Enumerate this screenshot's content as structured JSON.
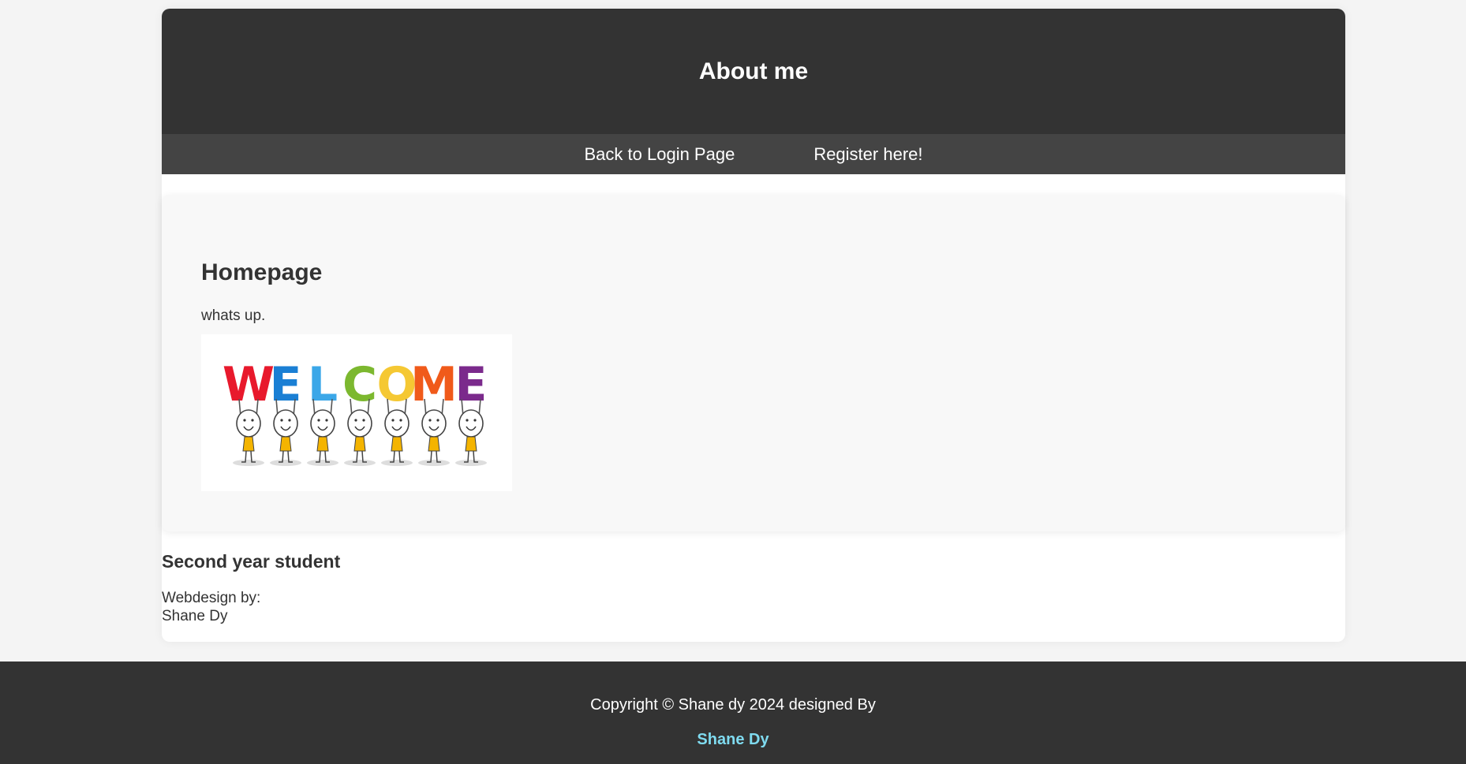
{
  "header": {
    "title": "About me"
  },
  "nav": {
    "items": [
      {
        "label": "Back to Login Page"
      },
      {
        "label": "Register here!"
      }
    ]
  },
  "main": {
    "heading": "Homepage",
    "text": "whats up.",
    "image": {
      "letters": [
        "W",
        "E",
        "L",
        "C",
        "O",
        "M",
        "E"
      ],
      "letter_colors": [
        "#e8192c",
        "#1a7fd4",
        "#3ba7e8",
        "#7cb82f",
        "#f5c833",
        "#f05a1a",
        "#7b2a8c"
      ]
    }
  },
  "aside": {
    "heading": "Second year student",
    "credit_label": "Webdesign by:",
    "credit_name": "Shane Dy"
  },
  "footer": {
    "copyright": "Copyright © Shane dy 2024 designed By",
    "designer": "Shane Dy"
  },
  "colors": {
    "header_bg": "#333333",
    "nav_bg": "#444444",
    "footer_link": "#7fdbf0"
  }
}
